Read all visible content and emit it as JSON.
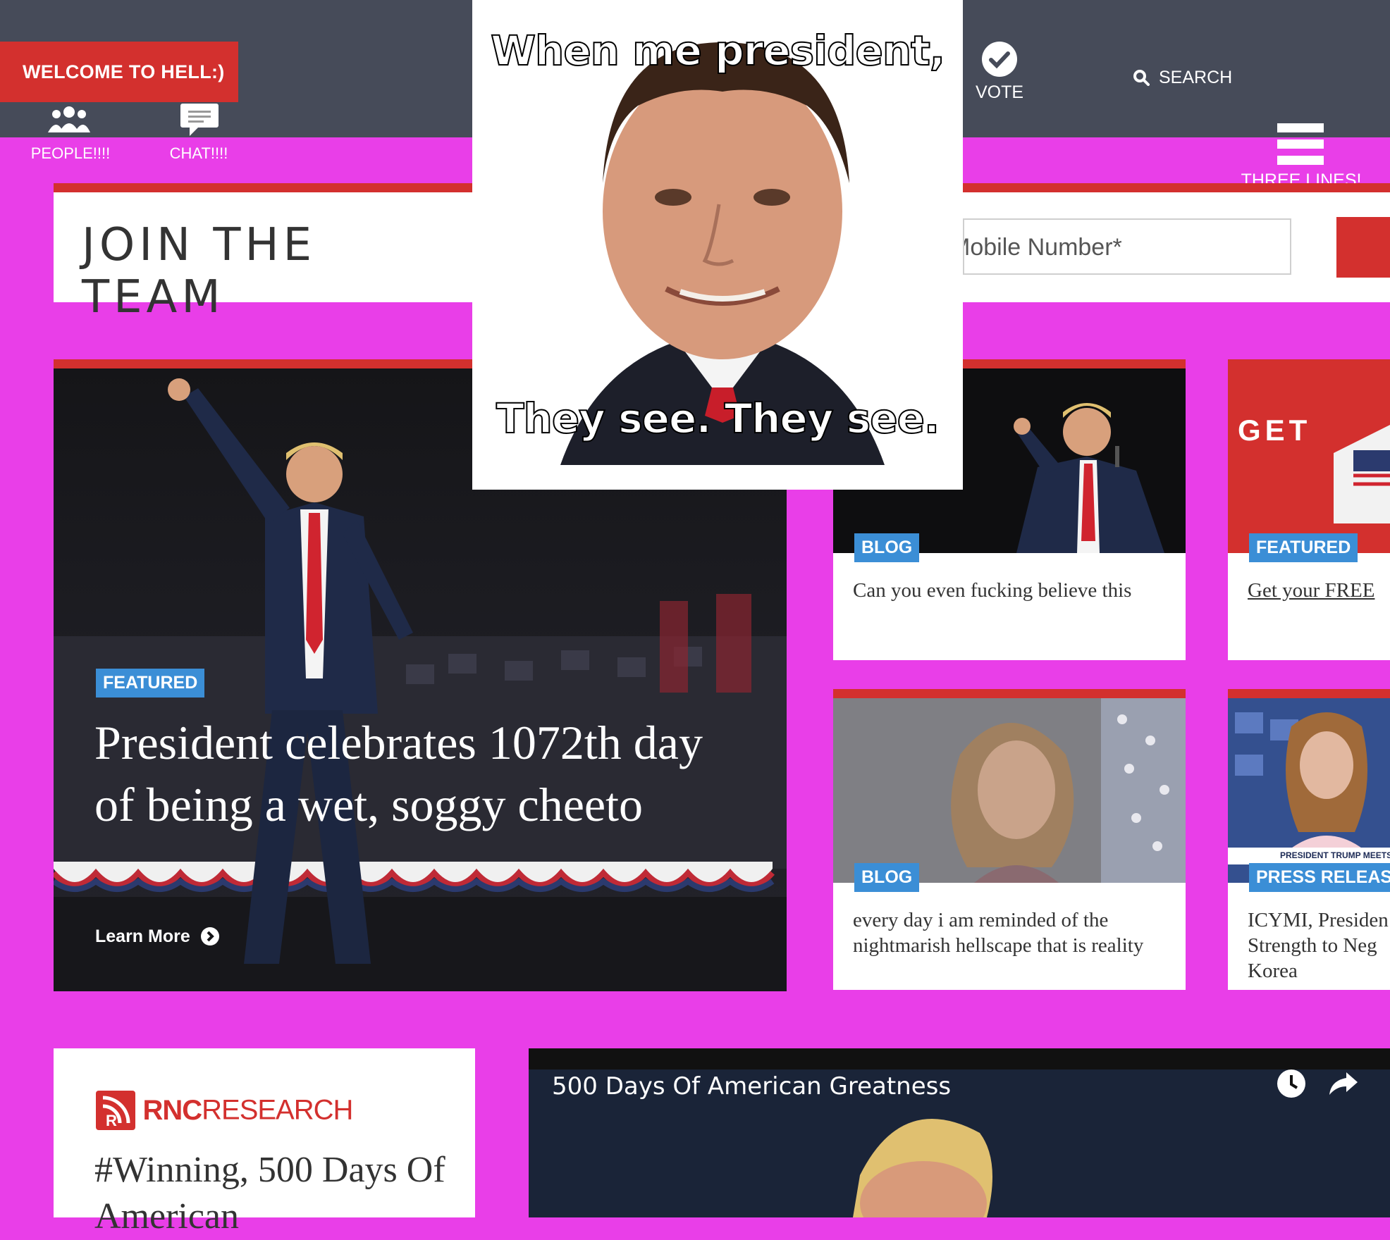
{
  "header": {
    "welcome_label": "WELCOME TO HELL:)",
    "nav": [
      {
        "label": "PEOPLE!!!!",
        "icon": "people-icon"
      },
      {
        "label": "CHAT!!!!",
        "icon": "chat-icon"
      },
      {
        "label": "VOTE",
        "icon": "check-circle-icon"
      },
      {
        "label": "SEARCH",
        "icon": "search-icon"
      },
      {
        "label": "THREE LINES!",
        "icon": "hamburger-icon"
      }
    ]
  },
  "join": {
    "title": "JOIN THE TEAM",
    "mobile_placeholder": "Mobile Number*"
  },
  "meme": {
    "top_text": "When me president,",
    "bottom_text": "They see. They see."
  },
  "hero": {
    "tag": "FEATURED",
    "title": "President celebrates 1072th day of being a wet, soggy cheeto",
    "cta": "Learn More"
  },
  "cards": [
    {
      "tag": "BLOG",
      "title": "Can you even fucking believe this"
    },
    {
      "tag": "FEATURED",
      "title": "Get your FREE",
      "image_text": "GET"
    },
    {
      "tag": "BLOG",
      "title": "every day i am reminded of the nightmarish hellscape that is reality"
    },
    {
      "tag": "PRESS RELEASE",
      "title": "ICYMI, Presiden Strength to Neg Korea",
      "image_text": "PRESIDENT TRUMP MEETS W"
    }
  ],
  "research": {
    "logo_bold": "RNC",
    "logo_light": "RESEARCH",
    "title": "#Winning, 500 Days Of American"
  },
  "video": {
    "title": "500 Days Of American Greatness"
  },
  "colors": {
    "page_bg": "#e93ee8",
    "topbar": "#464b59",
    "accent_red": "#d3302e",
    "tag_blue": "#3b8ed6"
  }
}
